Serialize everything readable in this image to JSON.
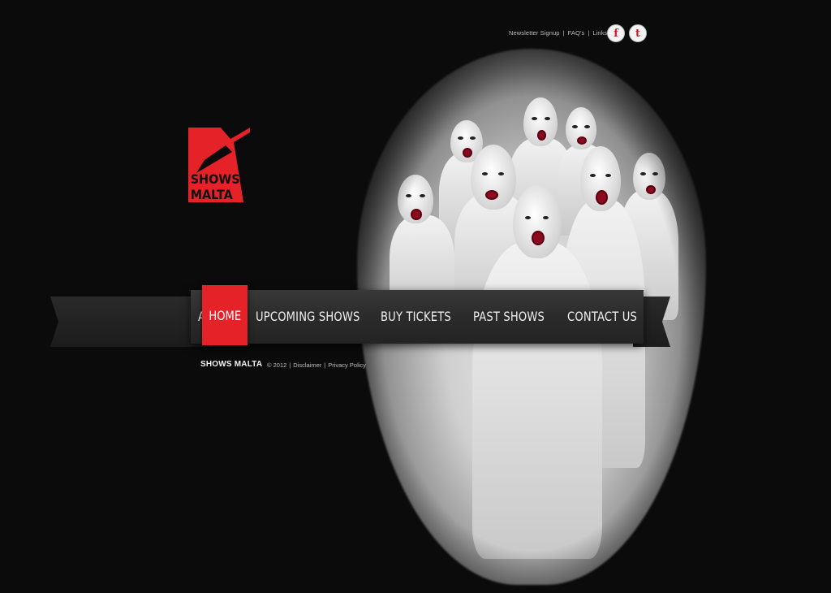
{
  "top_links": {
    "newsletter": "Newsletter Signup",
    "faqs": "FAQ's",
    "links": "Links",
    "separator": "|"
  },
  "social": {
    "facebook_glyph": "f",
    "twitter_glyph": "t",
    "facebook_icon": "facebook-icon",
    "twitter_icon": "twitter-icon"
  },
  "logo": {
    "line1": "SHOWS",
    "line2": "MALTA",
    "color": "#e42228"
  },
  "nav": {
    "items": [
      {
        "label": "HOME",
        "active": true
      },
      {
        "label": "ABOUT"
      },
      {
        "label": "UPCOMING SHOWS"
      },
      {
        "label": "BUY TICKETS"
      },
      {
        "label": "PAST SHOWS"
      },
      {
        "label": "CONTACT US"
      }
    ],
    "active_color": "#e42228"
  },
  "footer": {
    "brand": "SHOWS MALTA",
    "copyright": "© 2012",
    "disclaimer": "Disclaimer",
    "privacy": "Privacy Policy",
    "separator": "|"
  }
}
